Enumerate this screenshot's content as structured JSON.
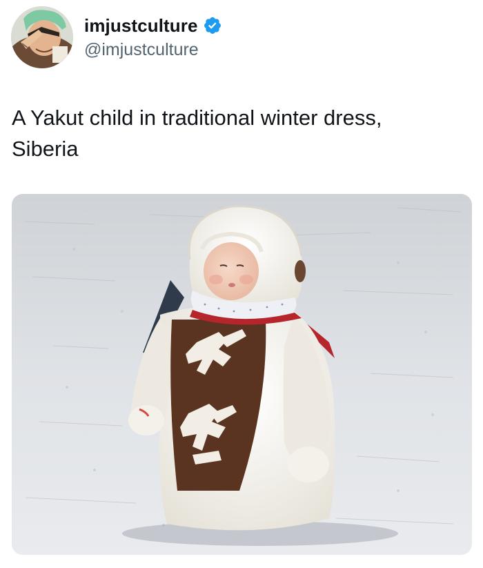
{
  "user": {
    "display_name": "imjustculture",
    "handle": "@imjustculture",
    "verified": true,
    "avatar_icon": "anime-character-avatar"
  },
  "tweet": {
    "text": "A Yakut child in traditional winter dress,\nSiberia"
  },
  "media": {
    "alt": "Child in white fur coat standing on snow"
  },
  "colors": {
    "verified_blue": "#1d9bf0",
    "text_primary": "#0f1419",
    "text_secondary": "#536471"
  }
}
